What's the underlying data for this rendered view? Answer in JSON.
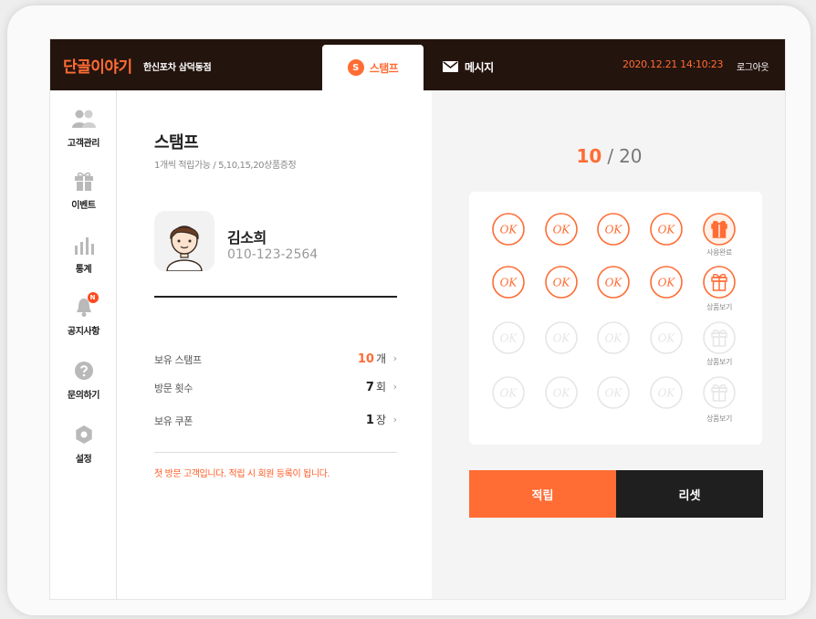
{
  "header": {
    "brand": "단골이야기",
    "store": "한신포차 삼덕동점",
    "tabs": [
      {
        "label": "스탬프",
        "icon": "stamp-s-icon",
        "badge": "S",
        "active": true
      },
      {
        "label": "메시지",
        "icon": "envelope-icon",
        "active": false
      }
    ],
    "datetime": "2020.12.21 14:10:23",
    "logout": "로그아웃"
  },
  "sidebar": {
    "items": [
      {
        "label": "고객관리",
        "icon": "customers-icon"
      },
      {
        "label": "이벤트",
        "icon": "gift-icon"
      },
      {
        "label": "통계",
        "icon": "bar-chart-icon"
      },
      {
        "label": "공지사항",
        "icon": "bell-icon",
        "badge": "N"
      },
      {
        "label": "문의하기",
        "icon": "question-icon"
      },
      {
        "label": "설정",
        "icon": "gear-icon"
      }
    ]
  },
  "stamp_page": {
    "title": "스탬프",
    "subtitle": "1개씩 적립가능 / 5,10,15,20상품증정",
    "customer": {
      "name": "김소희",
      "phone": "010-123-2564"
    },
    "info": [
      {
        "label": "보유 스탬프",
        "value": "10",
        "unit": "개",
        "accent": true
      },
      {
        "label": "방문 횟수",
        "value": "7",
        "unit": "회",
        "accent": false
      },
      {
        "label": "보유 쿠폰",
        "value": "1",
        "unit": "장",
        "accent": false
      }
    ],
    "notice": "첫 방문 고객입니다. 적립 시 회원 등록이 됩니다."
  },
  "stamp_board": {
    "current": "10",
    "separator": "/",
    "total": "20",
    "stamp_text": "OK",
    "gift_labels": [
      "사용완료",
      "상품보기",
      "상품보기",
      "상품보기"
    ]
  },
  "actions": {
    "save": "적립",
    "reset": "리셋"
  },
  "colors": {
    "accent": "#ff6c34",
    "header_bg": "#24140e",
    "dark_button": "#1f1f1f",
    "inactive": "#e6e6e6"
  }
}
